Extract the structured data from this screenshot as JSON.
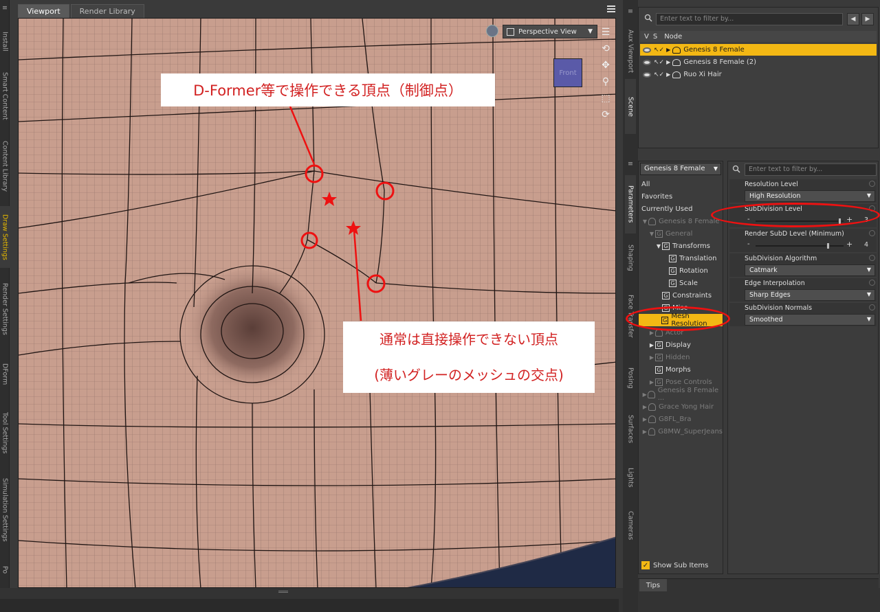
{
  "left_tabs": [
    {
      "label": "Install",
      "active": false
    },
    {
      "label": "Smart Content",
      "active": false
    },
    {
      "label": "Content Library",
      "active": false
    },
    {
      "label": "Draw Settings",
      "active": true
    },
    {
      "label": "Render Settings",
      "active": false
    },
    {
      "label": "DForm",
      "active": false
    },
    {
      "label": "Tool Settings",
      "active": false
    },
    {
      "label": "Simulation Settings",
      "active": false
    },
    {
      "label": "Po",
      "active": false
    }
  ],
  "viewport": {
    "tabs": [
      "Viewport",
      "Render Library"
    ],
    "active_tab": "Viewport",
    "camera_dropdown": "Perspective View",
    "cube_label": "Front",
    "callout_top": "D-Former等で操作できる頂点（制御点）",
    "callout_bottom_line1": "通常は直接操作できない頂点",
    "callout_bottom_line2": "(薄いグレーのメッシュの交点)"
  },
  "middle_tabs": [
    "Aux Viewport",
    "Scene",
    "Parameters",
    "Shaping",
    "Face Transfer",
    "Posing",
    "Surfaces",
    "Lights",
    "Cameras"
  ],
  "scene": {
    "filter_placeholder": "Enter text to filter by...",
    "headers": [
      "V",
      "S",
      "Node"
    ],
    "nodes": [
      {
        "name": "Genesis 8 Female",
        "selected": true
      },
      {
        "name": "Genesis 8 Female (2)",
        "selected": false
      },
      {
        "name": "Ruo Xi Hair",
        "selected": false
      }
    ]
  },
  "parameters": {
    "node_dropdown": "Genesis 8 Female",
    "filter_placeholder": "Enter text to filter by...",
    "tree": [
      {
        "label": "All",
        "indent": 0,
        "tri": "",
        "g": false,
        "dim": false,
        "selected": false
      },
      {
        "label": "Favorites",
        "indent": 0,
        "tri": "",
        "g": false,
        "dim": false,
        "selected": false
      },
      {
        "label": "Currently Used",
        "indent": 0,
        "tri": "",
        "g": false,
        "dim": false,
        "selected": false
      },
      {
        "label": "Genesis 8 Female",
        "indent": 0,
        "tri": "▼",
        "g": false,
        "fig": true,
        "dim": true,
        "selected": false
      },
      {
        "label": "General",
        "indent": 1,
        "tri": "▼",
        "g": true,
        "dim": true,
        "selected": false
      },
      {
        "label": "Transforms",
        "indent": 2,
        "tri": "▼",
        "g": true,
        "dim": false,
        "selected": false
      },
      {
        "label": "Translation",
        "indent": 3,
        "tri": "",
        "g": true,
        "dim": false,
        "selected": false
      },
      {
        "label": "Rotation",
        "indent": 3,
        "tri": "",
        "g": true,
        "dim": false,
        "selected": false
      },
      {
        "label": "Scale",
        "indent": 3,
        "tri": "",
        "g": true,
        "dim": false,
        "selected": false
      },
      {
        "label": "Constraints",
        "indent": 2,
        "tri": "",
        "g": true,
        "dim": false,
        "selected": false
      },
      {
        "label": "Misc",
        "indent": 2,
        "tri": "",
        "g": true,
        "dim": false,
        "selected": false
      },
      {
        "label": "Mesh Resolution",
        "indent": 2,
        "tri": "",
        "g": true,
        "dim": false,
        "selected": true
      },
      {
        "label": "Actor",
        "indent": 1,
        "tri": "▶",
        "g": false,
        "fig": true,
        "dim": true,
        "selected": false
      },
      {
        "label": "Display",
        "indent": 1,
        "tri": "▶",
        "g": true,
        "dim": false,
        "selected": false
      },
      {
        "label": "Hidden",
        "indent": 1,
        "tri": "▶",
        "g": true,
        "dim": true,
        "selected": false
      },
      {
        "label": "Morphs",
        "indent": 1,
        "tri": "",
        "g": true,
        "dim": false,
        "selected": false
      },
      {
        "label": "Pose Controls",
        "indent": 1,
        "tri": "▶",
        "g": true,
        "dim": true,
        "selected": false
      },
      {
        "label": "Genesis 8 Female ...",
        "indent": 0,
        "tri": "▶",
        "g": false,
        "fig": true,
        "dim": true,
        "selected": false
      },
      {
        "label": "Grace Yong Hair",
        "indent": 0,
        "tri": "▶",
        "g": false,
        "fig": true,
        "dim": true,
        "selected": false
      },
      {
        "label": "G8FL_Bra",
        "indent": 0,
        "tri": "▶",
        "g": false,
        "fig": true,
        "dim": true,
        "selected": false
      },
      {
        "label": "G8MW_SuperJeans",
        "indent": 0,
        "tri": "▶",
        "g": false,
        "fig": true,
        "dim": true,
        "selected": false
      }
    ],
    "show_sub_items": "Show Sub Items",
    "properties": [
      {
        "label": "Resolution Level",
        "kind": "dropdown",
        "value": "High Resolution"
      },
      {
        "label": "SubDivision Level",
        "kind": "slider",
        "value": "3",
        "fraction": 0.95
      },
      {
        "label": "Render SubD Level (Minimum)",
        "kind": "slider",
        "value": "4",
        "fraction": 0.82
      },
      {
        "label": "SubDivision Algorithm",
        "kind": "dropdown",
        "value": "Catmark"
      },
      {
        "label": "Edge Interpolation",
        "kind": "dropdown",
        "value": "Sharp Edges"
      },
      {
        "label": "SubDivision Normals",
        "kind": "dropdown",
        "value": "Smoothed"
      }
    ]
  },
  "tips_tab": "Tips",
  "colors": {
    "accent": "#f3b814",
    "annotation": "#dd2222",
    "skin": "#c89e8e"
  }
}
